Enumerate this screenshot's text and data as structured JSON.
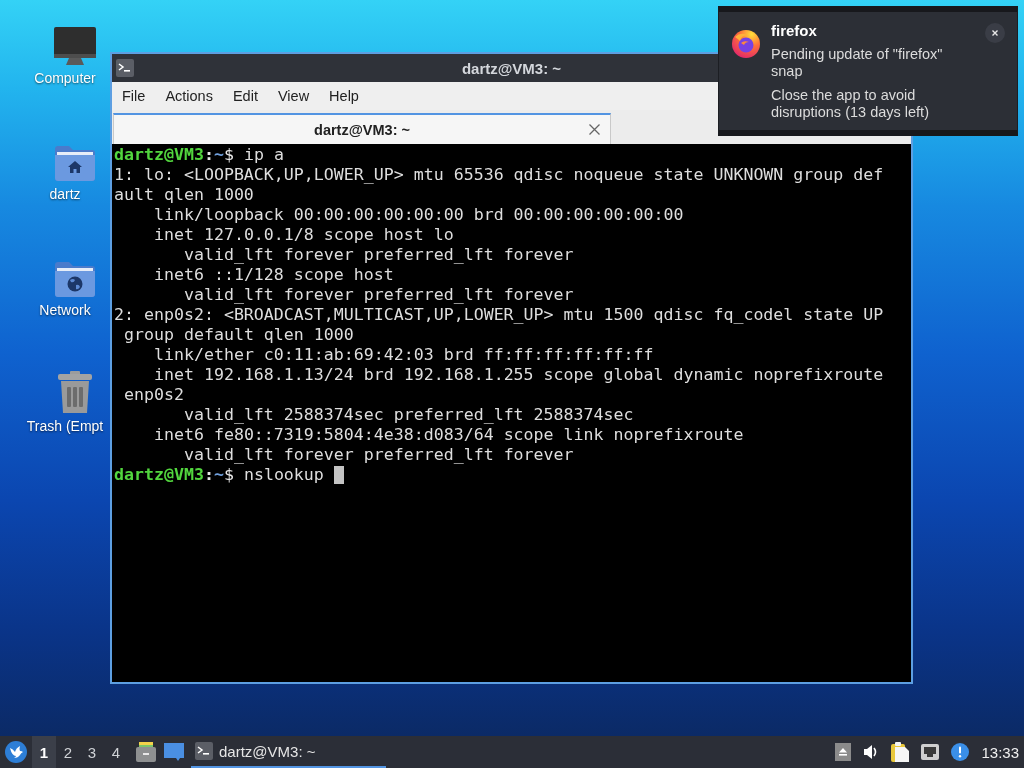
{
  "desktop": {
    "icons": [
      {
        "kind": "computer",
        "label": "Computer"
      },
      {
        "kind": "home_folder",
        "label": "dartz"
      },
      {
        "kind": "network_folder",
        "label": "Network"
      },
      {
        "kind": "trash",
        "label": "Trash (Empt"
      }
    ]
  },
  "terminal_window": {
    "title": "dartz@VM3: ~",
    "menu": [
      "File",
      "Actions",
      "Edit",
      "View",
      "Help"
    ],
    "tabs": [
      {
        "label": "dartz@VM3: ~",
        "selected": true
      }
    ],
    "lines": [
      {
        "kind": "prompt",
        "user_host": "dartz@VM3",
        "separator": ":",
        "path": "~",
        "symbol": "$",
        "command": "ip a",
        "cursor": false
      },
      {
        "kind": "output",
        "text": "1: lo: <LOOPBACK,UP,LOWER_UP> mtu 65536 qdisc noqueue state UNKNOWN group def"
      },
      {
        "kind": "output",
        "text": "ault qlen 1000"
      },
      {
        "kind": "output",
        "text": "    link/loopback 00:00:00:00:00:00 brd 00:00:00:00:00:00"
      },
      {
        "kind": "output",
        "text": "    inet 127.0.0.1/8 scope host lo"
      },
      {
        "kind": "output",
        "text": "       valid_lft forever preferred_lft forever"
      },
      {
        "kind": "output",
        "text": "    inet6 ::1/128 scope host"
      },
      {
        "kind": "output",
        "text": "       valid_lft forever preferred_lft forever"
      },
      {
        "kind": "output",
        "text": "2: enp0s2: <BROADCAST,MULTICAST,UP,LOWER_UP> mtu 1500 qdisc fq_codel state UP"
      },
      {
        "kind": "output",
        "text": " group default qlen 1000"
      },
      {
        "kind": "output",
        "text": "    link/ether c0:11:ab:69:42:03 brd ff:ff:ff:ff:ff:ff"
      },
      {
        "kind": "output",
        "text": "    inet 192.168.1.13/24 brd 192.168.1.255 scope global dynamic noprefixroute"
      },
      {
        "kind": "output",
        "text": " enp0s2"
      },
      {
        "kind": "output",
        "text": "       valid_lft 2588374sec preferred_lft 2588374sec"
      },
      {
        "kind": "output",
        "text": "    inet6 fe80::7319:5804:4e38:d083/64 scope link noprefixroute"
      },
      {
        "kind": "output",
        "text": "       valid_lft forever preferred_lft forever"
      },
      {
        "kind": "prompt",
        "user_host": "dartz@VM3",
        "separator": ":",
        "path": "~",
        "symbol": "$",
        "command": "nslookup",
        "cursor": true
      }
    ]
  },
  "notification": {
    "app": "firefox",
    "message": "Pending update of \"firefox\" snap",
    "detail": "Close the app to avoid disruptions (13 days left)"
  },
  "taskbar": {
    "workspaces": [
      {
        "label": "1",
        "selected": true
      },
      {
        "label": "2",
        "selected": false
      },
      {
        "label": "3",
        "selected": false
      },
      {
        "label": "4",
        "selected": false
      }
    ],
    "tasks": [
      {
        "label": "dartz@VM3: ~",
        "selected": true
      }
    ],
    "clock": "13:33"
  }
}
